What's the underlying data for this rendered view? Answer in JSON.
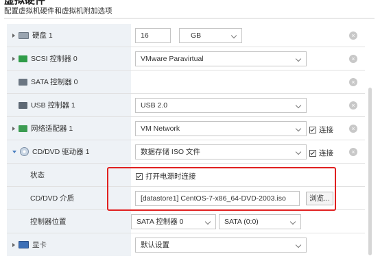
{
  "header": {
    "title": "虚拟硬件",
    "subtitle": "配置虚拟机硬件和虚拟机附加选项"
  },
  "rows": {
    "disk": {
      "label": "硬盘 1",
      "size": "16",
      "unit": "GB"
    },
    "scsi": {
      "label": "SCSI 控制器 0",
      "value": "VMware Paravirtual"
    },
    "sata": {
      "label": "SATA 控制器 0"
    },
    "usb": {
      "label": "USB 控制器 1",
      "value": "USB 2.0"
    },
    "net": {
      "label": "网络适配器 1",
      "value": "VM Network",
      "connect": "连接"
    },
    "cd": {
      "label": "CD/DVD 驱动器 1",
      "value": "数据存储 ISO 文件",
      "connect": "连接"
    },
    "status": {
      "label": "状态",
      "value": "打开电源时连接"
    },
    "media": {
      "label": "CD/DVD 介质",
      "value": "[datastore1] CentOS-7-x86_64-DVD-2003.iso",
      "browse": "浏览..."
    },
    "ctrl": {
      "label": "控制器位置",
      "value": "SATA 控制器 0",
      "port": "SATA (0:0)"
    },
    "video": {
      "label": "显卡",
      "value": "默认设置"
    }
  },
  "remove_symbol": "×"
}
